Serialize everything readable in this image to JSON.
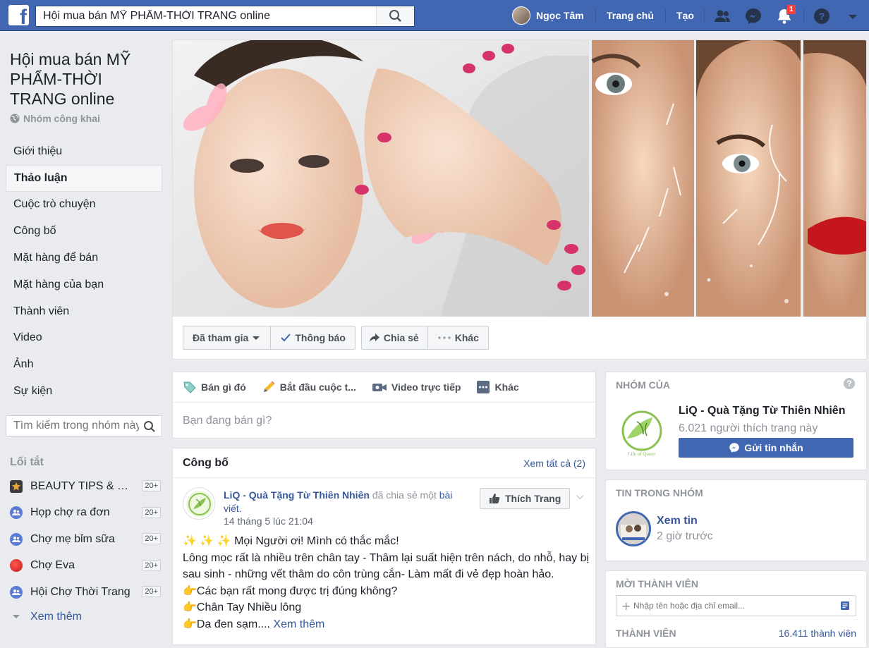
{
  "topbar": {
    "search_value": "Hội mua bán MỸ PHẨM-THỜI TRANG online",
    "user_name": "Ngọc Tâm",
    "home": "Trang chủ",
    "create": "Tạo",
    "notification_count": "1"
  },
  "group": {
    "title": "Hội mua bán MỸ PHẨM-THỜI TRANG online",
    "type": "Nhóm công khai"
  },
  "menu": [
    "Giới thiệu",
    "Thảo luận",
    "Cuộc trò chuyện",
    "Công bố",
    "Mặt hàng để bán",
    "Mặt hàng của bạn",
    "Thành viên",
    "Video",
    "Ảnh",
    "Sự kiện"
  ],
  "group_search_placeholder": "Tìm kiếm trong nhóm này",
  "shortcuts": {
    "heading": "Lối tắt",
    "items": [
      {
        "name": "BEAUTY TIPS & REVIEW",
        "count": "20+"
      },
      {
        "name": "Họp chợ ra đơn",
        "count": "20+"
      },
      {
        "name": "Chợ mẹ bỉm sữa",
        "count": "20+"
      },
      {
        "name": "Chợ Eva",
        "count": "20+"
      },
      {
        "name": "Hội Chợ Thời Trang",
        "count": "20+"
      }
    ],
    "see_more": "Xem thêm"
  },
  "actions": {
    "joined": "Đã tham gia",
    "notify": "Thông báo",
    "share": "Chia sẻ",
    "more": "Khác"
  },
  "composer": {
    "tabs": [
      "Bán gì đó",
      "Bắt đầu cuộc t...",
      "Video trực tiếp",
      "Khác"
    ],
    "placeholder": "Bạn đang bán gì?"
  },
  "announcement": {
    "title": "Công bố",
    "see_all": "Xem tất cả (2)",
    "post": {
      "author": "LiQ - Quà Tặng Từ Thiên Nhiên",
      "action": "đã chia sẻ một",
      "link": "bài viết",
      "time": "14 tháng 5 lúc 21:04",
      "like_page": "Thích Trang",
      "line1": "✨ ✨ ✨ Mọi Người ơi! Mình có thắc mắc!",
      "line2": "Lông mọc rất là nhiều trên chân tay - Thâm lại suất hiện trên nách, do nhỗ, hay bị sau sinh - những vết thâm do côn trùng cắn- Làm mất đi vẻ đẹp hoàn hảo.",
      "line3": "👉Các bạn rất mong được trị đúng không?",
      "line4": "👉Chân Tay Nhiều lông",
      "line5": "👉Da đen sạm....",
      "see_more": "Xem thêm"
    }
  },
  "right": {
    "page_card": {
      "heading": "NHÓM CỦA",
      "page_name": "LiQ - Quà Tặng Từ Thiên Nhiên",
      "likes": "6.021 người thích trang này",
      "message_btn": "Gửi tin nhắn"
    },
    "news_card": {
      "heading": "TIN TRONG NHÓM",
      "title": "Xem tin",
      "time": "2 giờ trước"
    },
    "invite_card": {
      "heading": "MỜI THÀNH VIÊN",
      "placeholder": "Nhập tên hoặc địa chỉ email...",
      "members_label": "THÀNH VIÊN",
      "members_count": "16.411 thành viên"
    }
  },
  "colors": {
    "brand": "#4267b2",
    "link": "#365899",
    "muted": "#90949c",
    "badge": "#fa3e3e"
  }
}
